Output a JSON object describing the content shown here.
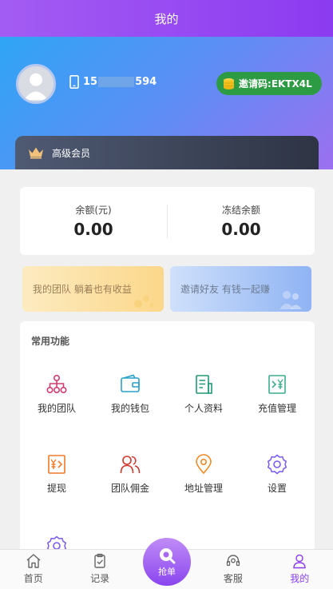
{
  "topbar": {
    "title": "我的"
  },
  "profile": {
    "phone_prefix": "15",
    "phone_suffix": "594",
    "invite_label": "邀请码:",
    "invite_code": "EKTX4L"
  },
  "vip": {
    "label": "高级会员"
  },
  "balance": {
    "items": [
      {
        "label": "余额(元)",
        "value": "0.00"
      },
      {
        "label": "冻结余额",
        "value": "0.00"
      }
    ]
  },
  "banners": {
    "team": "我的团队 躺着也有收益",
    "invite": "邀请好友 有钱一起赚"
  },
  "functions": {
    "title": "常用功能",
    "items": [
      {
        "label": "我的团队",
        "icon": "team-tree-icon"
      },
      {
        "label": "我的钱包",
        "icon": "wallet-icon"
      },
      {
        "label": "个人资料",
        "icon": "profile-doc-icon"
      },
      {
        "label": "充值管理",
        "icon": "recharge-icon"
      },
      {
        "label": "提现",
        "icon": "withdraw-icon"
      },
      {
        "label": "团队佣金",
        "icon": "team-commission-icon"
      },
      {
        "label": "地址管理",
        "icon": "location-pin-icon"
      },
      {
        "label": "设置",
        "icon": "gear-icon"
      }
    ]
  },
  "tabbar": {
    "items": [
      {
        "label": "首页",
        "icon": "home-icon"
      },
      {
        "label": "记录",
        "icon": "record-icon"
      },
      {
        "label": "抢单",
        "icon": "grab-order-icon"
      },
      {
        "label": "客服",
        "icon": "headset-icon"
      },
      {
        "label": "我的",
        "icon": "user-icon",
        "active": true
      }
    ]
  },
  "colors": {
    "accent": "#8b3df0",
    "invite_badge": "#2d9b43",
    "vip_bar": "#2e3444"
  }
}
